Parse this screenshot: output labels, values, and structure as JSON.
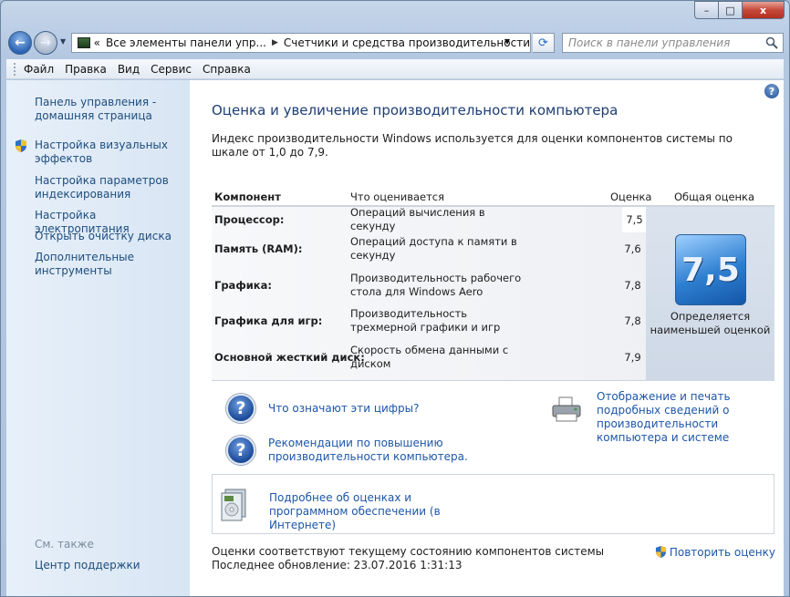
{
  "window": {
    "caption_buttons": {
      "minimize": "–",
      "maximize": "□",
      "close": "x"
    }
  },
  "address": {
    "prefix": "«",
    "crumbs": [
      "Все элементы панели упр...",
      "Счетчики и средства производительности"
    ],
    "separator": "▶"
  },
  "search": {
    "placeholder": "Поиск в панели управления"
  },
  "menu": [
    "Файл",
    "Правка",
    "Вид",
    "Сервис",
    "Справка"
  ],
  "sidebar": {
    "items": [
      "Панель управления - домашняя страница",
      "Настройка визуальных эффектов",
      "Настройка параметров индексирования",
      "Настройка электропитания",
      "Открыть очистку диска",
      "Дополнительные инструменты"
    ],
    "see_also": "См. также",
    "support": "Центр поддержки"
  },
  "main": {
    "title": "Оценка и увеличение производительности компьютера",
    "description": "Индекс производительности Windows используется для оценки компонентов системы по шкале от 1,0 до 7,9.",
    "table": {
      "headers": {
        "component": "Компонент",
        "what": "Что оценивается",
        "score": "Оценка",
        "overall": "Общая оценка"
      },
      "rows": [
        {
          "component": "Процессор:",
          "what": "Операций вычисления в секунду",
          "score": "7,5"
        },
        {
          "component": "Память (RAM):",
          "what": "Операций доступа к памяти в секунду",
          "score": "7,6"
        },
        {
          "component": "Графика:",
          "what": "Производительность рабочего стола для Windows Aero",
          "score": "7,8"
        },
        {
          "component": "Графика для игр:",
          "what": "Производительность трехмерной графики и игр",
          "score": "7,8"
        },
        {
          "component": "Основной жесткий диск:",
          "what": "Скорость обмена данными с диском",
          "score": "7,9"
        }
      ],
      "overall_score": "7,5",
      "overall_text": "Определяется наименьшей оценкой"
    },
    "links": {
      "what_numbers": "Что означают эти цифры?",
      "tips": "Рекомендации по повышению производительности компьютера.",
      "print": "Отображение и печать подробных сведений о производительности компьютера и системе",
      "online": "Подробнее об оценках и программном обеспечении (в Интернете)"
    },
    "status_line1": "Оценки соответствуют текущему состоянию компонентов системы",
    "status_line2": "Последнее обновление: 23.07.2016 1:31:13",
    "repeat": "Повторить оценку"
  }
}
